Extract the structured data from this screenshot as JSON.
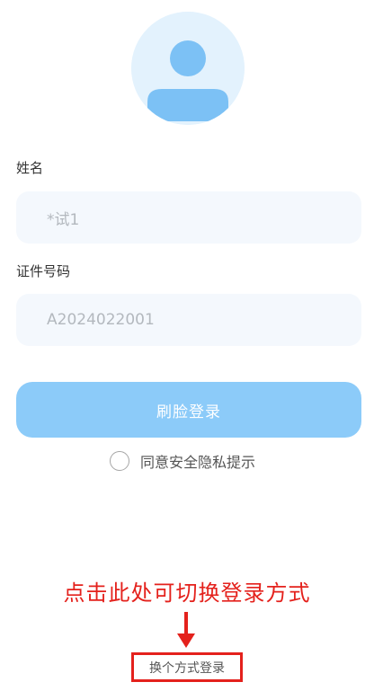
{
  "form": {
    "name_label": "姓名",
    "name_value": "*试1",
    "id_label": "证件号码",
    "id_value": "A2024022001"
  },
  "actions": {
    "face_login_label": "刷脸登录",
    "agree_label": "同意安全隐私提示",
    "switch_method_label": "换个方式登录"
  },
  "annotation": {
    "hint_text": "点击此处可切换登录方式"
  },
  "colors": {
    "primary_button": "#8ccbf9",
    "avatar_bg": "#e3f2fd",
    "annotation_red": "#e4211c"
  },
  "icons": {
    "avatar": "user-avatar-icon",
    "agree": "radio-circle-icon",
    "arrow": "arrow-down-icon"
  }
}
